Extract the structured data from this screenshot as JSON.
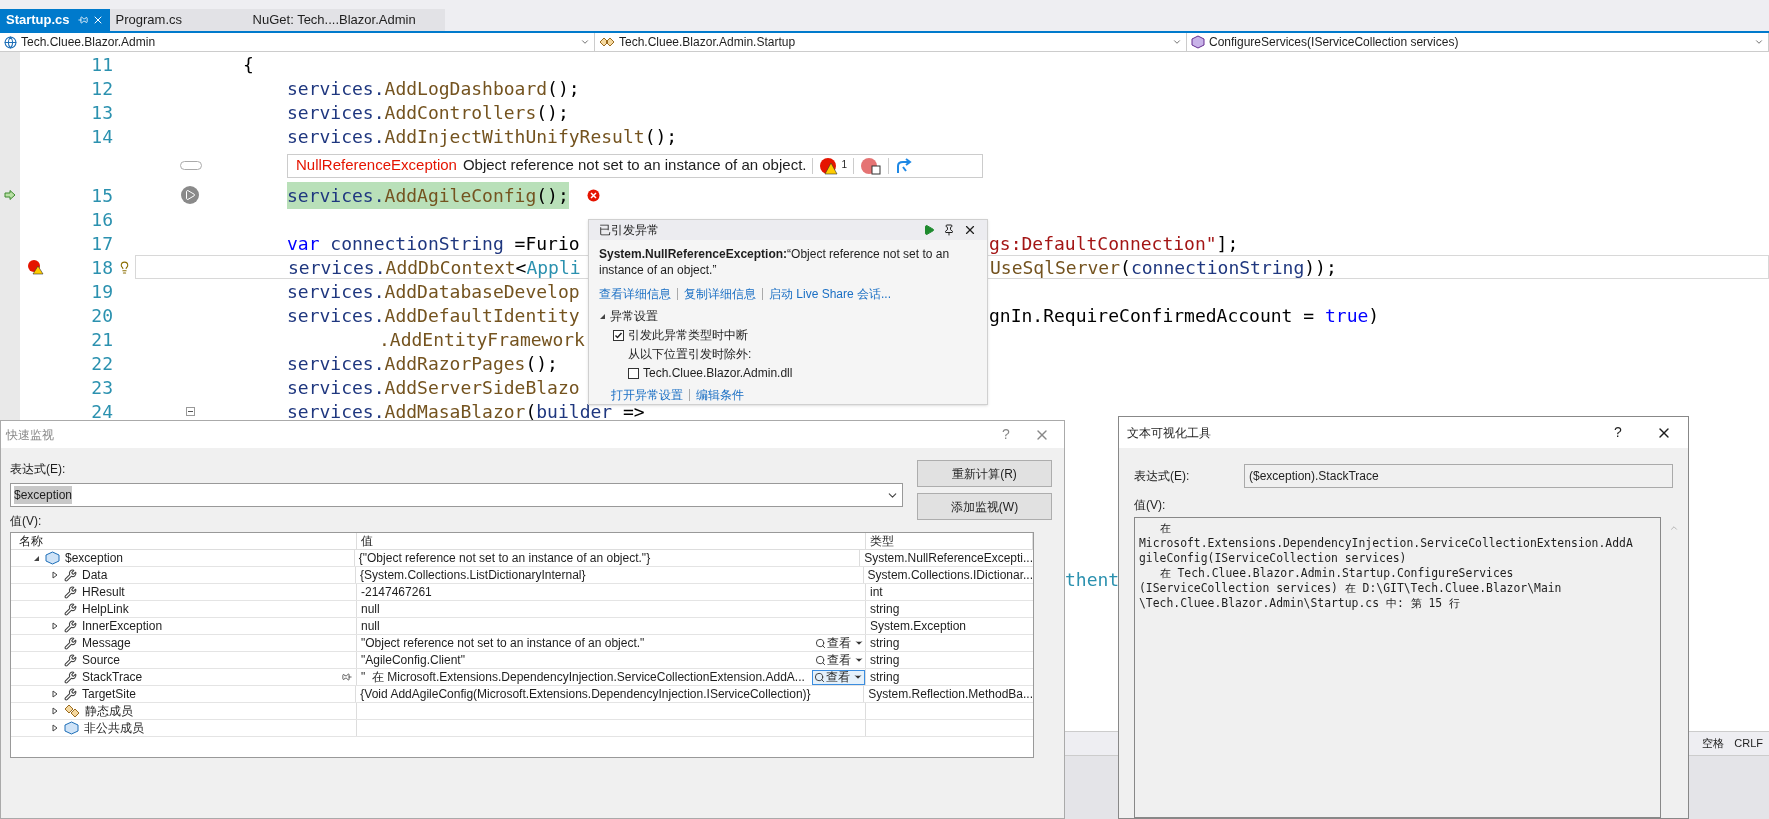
{
  "tabs": [
    {
      "label": "Startup.cs",
      "selected": true
    },
    {
      "label": "Program.cs",
      "selected": false
    },
    {
      "label": "NuGet: Tech....Blazor.Admin",
      "selected": false
    }
  ],
  "nav": [
    {
      "kind": "project",
      "label": "Tech.Cluee.Blazor.Admin"
    },
    {
      "kind": "class",
      "label": "Tech.Cluee.Blazor.Admin.Startup"
    },
    {
      "kind": "method",
      "label": "ConfigureServices(IServiceCollection services)"
    }
  ],
  "editor": {
    "lines": [
      {
        "number": "11",
        "kind": "brace",
        "left": [
          {
            "text": "{",
            "kind": "punct"
          }
        ]
      },
      {
        "number": "12",
        "left": [
          {
            "text": "services.",
            "kind": "var"
          },
          {
            "text": "AddLogDashboard",
            "kind": "method"
          },
          {
            "text": "();",
            "kind": "punct"
          }
        ]
      },
      {
        "number": "13",
        "left": [
          {
            "text": "services.",
            "kind": "var"
          },
          {
            "text": "AddControllers",
            "kind": "method"
          },
          {
            "text": "();",
            "kind": "punct"
          }
        ]
      },
      {
        "number": "14",
        "left": [
          {
            "text": "services.",
            "kind": "var"
          },
          {
            "text": "AddInjectWithUnifyResult",
            "kind": "method"
          },
          {
            "text": "();",
            "kind": "punct"
          }
        ],
        "codelens": {
          "exception": "NullReferenceException",
          "message": "Object reference not set to an instance of an object.",
          "count": "1"
        }
      },
      {
        "number": "15",
        "executing": true,
        "highlight": true,
        "error": true,
        "left": [
          {
            "text": "services.",
            "kind": "var"
          },
          {
            "text": "AddAgileConfig",
            "kind": "method"
          },
          {
            "text": "();",
            "kind": "punct"
          }
        ]
      },
      {
        "number": "16"
      },
      {
        "number": "17",
        "left": [
          {
            "text": "var",
            "kind": "keyword"
          },
          {
            "text": " connectionString ",
            "kind": "var"
          },
          {
            "text": "=Furio",
            "kind": "punct"
          }
        ],
        "right": [
          {
            "text": "gs:DefaultConnection\"",
            "kind": "string"
          },
          {
            "text": "];",
            "kind": "punct"
          }
        ]
      },
      {
        "number": "18",
        "caret": true,
        "breakpoint_warning": true,
        "lightbulb": true,
        "left": [
          {
            "text": "services.",
            "kind": "var"
          },
          {
            "text": "AddDbContext",
            "kind": "method"
          },
          {
            "text": "<",
            "kind": "punct"
          },
          {
            "text": "Appli",
            "kind": "type"
          }
        ],
        "right": [
          {
            "text": "UseSqlServer",
            "kind": "method"
          },
          {
            "text": "(",
            "kind": "punct"
          },
          {
            "text": "connectionString",
            "kind": "var"
          },
          {
            "text": "));",
            "kind": "punct"
          }
        ]
      },
      {
        "number": "19",
        "left": [
          {
            "text": "services.",
            "kind": "var"
          },
          {
            "text": "AddDatabaseDevelop",
            "kind": "method"
          }
        ]
      },
      {
        "number": "20",
        "left": [
          {
            "text": "services.",
            "kind": "var"
          },
          {
            "text": "AddDefaultIdentity",
            "kind": "method"
          }
        ],
        "right": [
          {
            "text": "gnIn.RequireConfirmedAccount = ",
            "kind": "punct"
          },
          {
            "text": "true",
            "kind": "keyword"
          },
          {
            "text": ")",
            "kind": "punct"
          }
        ]
      },
      {
        "number": "21",
        "kind": "continuation",
        "left": [
          {
            "text": ".AddEntityFramework",
            "kind": "method"
          }
        ]
      },
      {
        "number": "22",
        "left": [
          {
            "text": "services.",
            "kind": "var"
          },
          {
            "text": "AddRazorPages",
            "kind": "method"
          },
          {
            "text": "();",
            "kind": "punct"
          }
        ]
      },
      {
        "number": "23",
        "left": [
          {
            "text": "services.",
            "kind": "var"
          },
          {
            "text": "AddServerSideBlazo",
            "kind": "method"
          }
        ]
      },
      {
        "number": "24",
        "collapsible": true,
        "left": [
          {
            "text": "services.",
            "kind": "var"
          },
          {
            "text": "AddMasaBlazor",
            "kind": "method"
          },
          {
            "text": "(",
            "kind": "punct"
          },
          {
            "text": "builder",
            "kind": "var"
          },
          {
            "text": " =>",
            "kind": "punct"
          }
        ]
      }
    ],
    "fragment": "thent"
  },
  "status_bar": [
    "空格",
    "CRLF"
  ],
  "exception_popup": {
    "title": "已引发异常",
    "message": "**System.NullReferenceException:**“Object reference not set to an instance of an object.”",
    "links": [
      "查看详细信息",
      "复制详细信息",
      "启动 Live Share 会话..."
    ],
    "settings": {
      "label": "异常设置",
      "expanded": true,
      "break_option": {
        "label": "引发此异常类型时中断",
        "checked": true
      },
      "except_label": "从以下位置引发时除外:",
      "except_option": {
        "label": "Tech.Cluee.Blazor.Admin.dll",
        "checked": false
      }
    },
    "footer_links": [
      "打开异常设置",
      "编辑条件"
    ]
  },
  "quick_watch": {
    "title": "快速监视",
    "help": "?",
    "expression_label": "表达式(E):",
    "expression": "$exception",
    "buttons": [
      "重新计算(R)",
      "添加监视(W)"
    ],
    "value_label": "值(V):",
    "columns": [
      "名称",
      "值",
      "类型"
    ],
    "rows": [
      {
        "name": "$exception",
        "kind": "object",
        "expanded": true,
        "value": "{\"Object reference not set to an instance of an object.\"}",
        "type": "System.NullReferenceExcepti...",
        "children": [
          {
            "name": "Data",
            "kind": "property",
            "expanded": false,
            "value": "{System.Collections.ListDictionaryInternal}",
            "type": "System.Collections.IDictionar..."
          },
          {
            "name": "HResult",
            "kind": "property",
            "value": "-2147467261",
            "type": "int"
          },
          {
            "name": "HelpLink",
            "kind": "property",
            "value": "null",
            "type": "string"
          },
          {
            "name": "InnerException",
            "kind": "property",
            "expanded": false,
            "value": "null",
            "type": "System.Exception"
          },
          {
            "name": "Message",
            "kind": "property",
            "value": "\"Object reference not set to an instance of an object.\"",
            "type": "string",
            "view": {
              "label": "查看",
              "focused": false
            }
          },
          {
            "name": "Source",
            "kind": "property",
            "value": "\"AgileConfig.Client\"",
            "type": "string",
            "view": {
              "label": "查看",
              "focused": false
            }
          },
          {
            "name": "StackTrace",
            "kind": "property",
            "pin": true,
            "value": "\"  在 Microsoft.Extensions.DependencyInjection.ServiceCollectionExtension.AddA...",
            "type": "string",
            "view": {
              "label": "查看",
              "focused": true
            }
          },
          {
            "name": "TargetSite",
            "kind": "property",
            "expanded": false,
            "value": "{Void AddAgileConfig(Microsoft.Extensions.DependencyInjection.IServiceCollection)}",
            "type": "System.Reflection.MethodBa..."
          },
          {
            "name": "静态成员",
            "kind": "static",
            "expanded": false
          },
          {
            "name": "非公共成员",
            "kind": "object",
            "expanded": false
          }
        ]
      }
    ]
  },
  "text_visualizer": {
    "title": "文本可视化工具",
    "help": "?",
    "expression_label": "表达式(E):",
    "expression": "($exception).StackTrace",
    "value_label": "值(V):",
    "value": "   在\nMicrosoft.Extensions.DependencyInjection.ServiceCollectionExtension.AddA\ngileConfig(IServiceCollection services)\n   在 Tech.Cluee.Blazor.Admin.Startup.ConfigureServices\n(IServiceCollection services) 在 D:\\GIT\\Tech.Cluee.Blazor\\Main\n\\Tech.Cluee.Blazor.Admin\\Startup.cs 中: 第 15 行"
  }
}
